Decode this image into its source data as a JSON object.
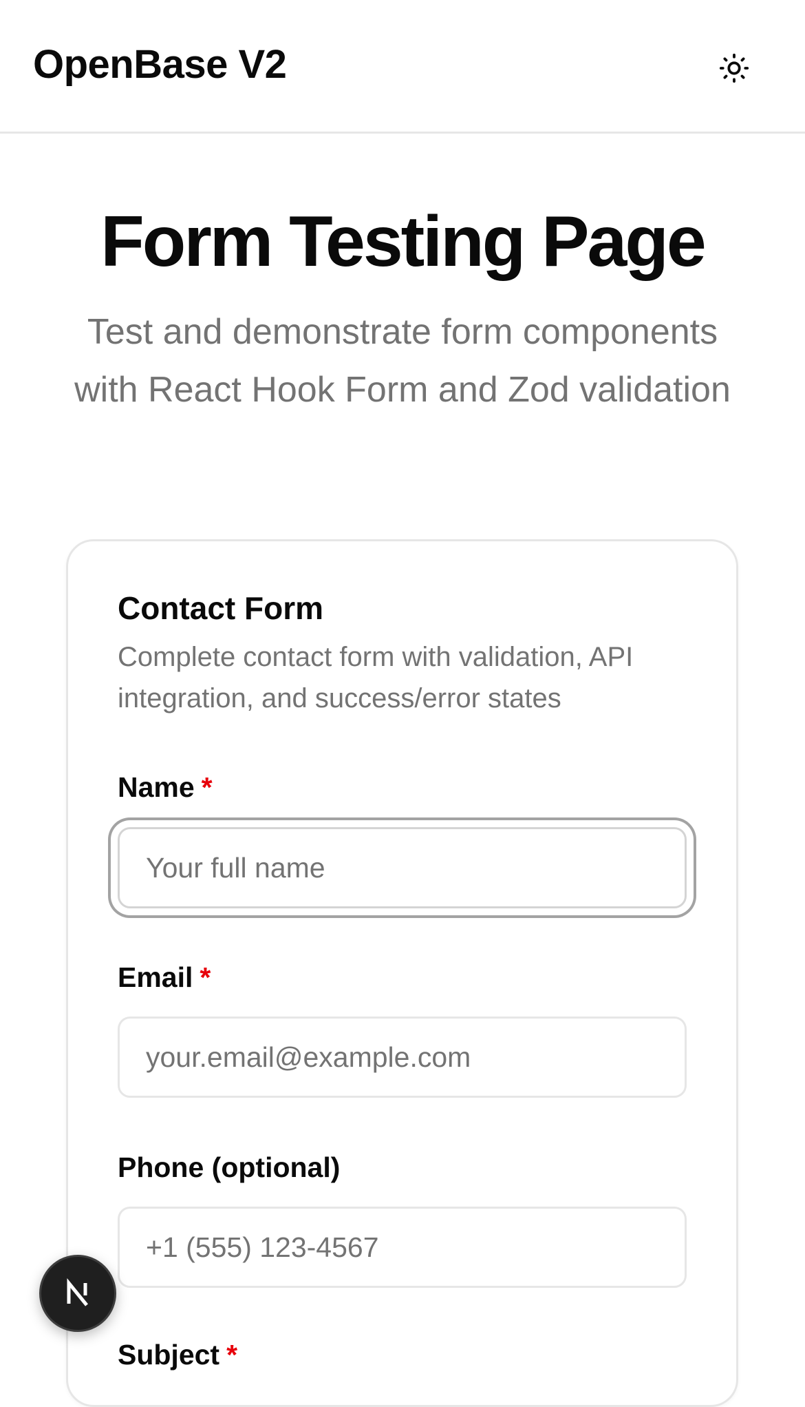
{
  "header": {
    "brand": "OpenBase V2",
    "theme_icon": "sun-icon"
  },
  "page": {
    "title": "Form Testing Page",
    "subtitle": "Test and demonstrate form components with React Hook Form and Zod validation"
  },
  "form": {
    "title": "Contact Form",
    "description": "Complete contact form with validation, API integration, and success/error states",
    "required_marker": "*",
    "fields": {
      "name": {
        "label": "Name",
        "placeholder": "Your full name",
        "value": ""
      },
      "email": {
        "label": "Email",
        "placeholder": "your.email@example.com",
        "value": ""
      },
      "phone": {
        "label": "Phone (optional)",
        "placeholder": "+1 (555) 123-4567",
        "value": ""
      },
      "subject": {
        "label": "Subject"
      }
    }
  },
  "dev_badge": {
    "letter": "N",
    "icon": "nextjs-logo-icon"
  },
  "colors": {
    "text": "#0a0a0a",
    "muted": "#737373",
    "border": "#e6e6e6",
    "required": "#e7000b"
  }
}
